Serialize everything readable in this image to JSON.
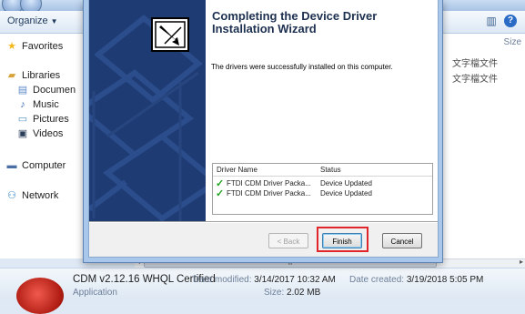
{
  "explorer": {
    "toolbar": {
      "organize_label": "Organize",
      "size_col": "Size"
    },
    "nav": {
      "favorites": "Favorites",
      "libraries": "Libraries",
      "documents": "Documen",
      "music": "Music",
      "pictures": "Pictures",
      "videos": "Videos",
      "computer": "Computer",
      "network": "Network"
    },
    "side_fragments": [
      "文字檔文件",
      "文字檔文件"
    ],
    "scroll_thumb": "III",
    "details": {
      "name": "CDM v2.12.16 WHQL Certified",
      "type": "Application",
      "modified_label": "Date modified:",
      "modified_value": "3/14/2017 10:32 AM",
      "size_label": "Size:",
      "size_value": "2.02 MB",
      "created_label": "Date created:",
      "created_value": "3/19/2018 5:05 PM"
    }
  },
  "wizard": {
    "title": "Completing the Device Driver Installation Wizard",
    "message": "The drivers were successfully installed on this computer.",
    "table": {
      "headers": [
        "Driver Name",
        "Status"
      ],
      "rows": [
        {
          "name": "FTDI CDM Driver Packa...",
          "status": "Device Updated"
        },
        {
          "name": "FTDI CDM Driver Packa...",
          "status": "Device Updated"
        }
      ]
    },
    "buttons": {
      "back": "< Back",
      "finish": "Finish",
      "cancel": "Cancel"
    }
  },
  "colors": {
    "banner": "#1f3b74",
    "highlight": "#e0262b",
    "check": "#21a321",
    "title": "#1d3050"
  }
}
